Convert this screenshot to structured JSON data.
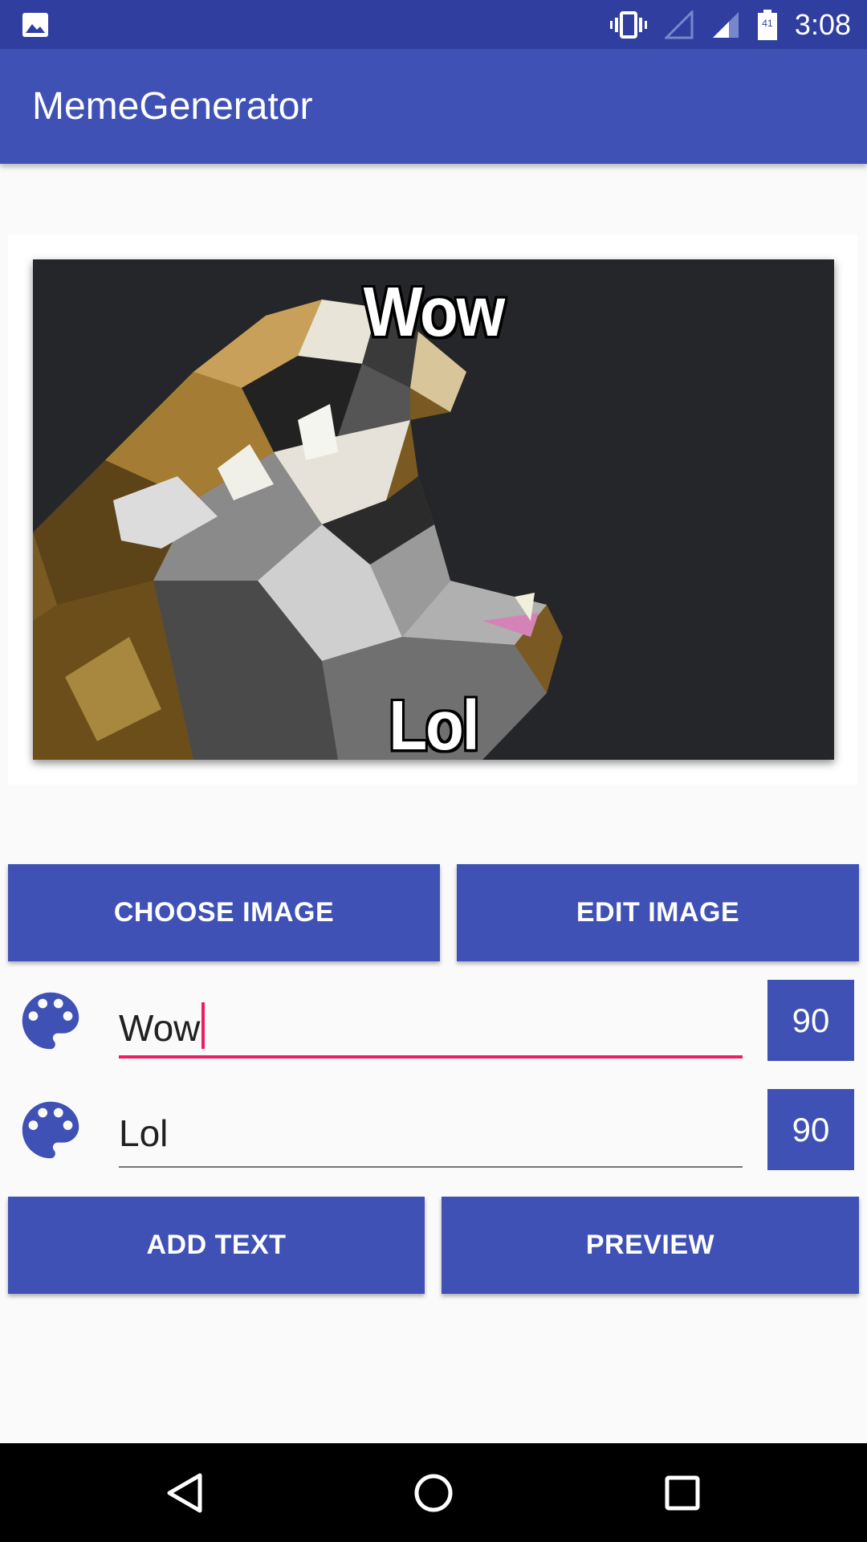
{
  "status_bar": {
    "time": "3:08",
    "battery_level": "41"
  },
  "app_bar": {
    "title": "MemeGenerator"
  },
  "meme": {
    "top_text": "Wow",
    "bottom_text": "Lol"
  },
  "buttons": {
    "choose_image": "CHOOSE IMAGE",
    "edit_image": "EDIT IMAGE",
    "add_text": "ADD TEXT",
    "preview": "PREVIEW"
  },
  "text_rows": [
    {
      "value": "Wow",
      "size": "90",
      "focused": true
    },
    {
      "value": "Lol",
      "size": "90",
      "focused": false
    }
  ],
  "colors": {
    "primary": "#3f51b5",
    "primary_dark": "#303f9f",
    "accent": "#e91e63"
  },
  "icons": [
    "image-notification-icon",
    "vibrate-icon",
    "signal-empty-icon",
    "signal-icon",
    "battery-icon",
    "palette-icon",
    "back-icon",
    "home-icon",
    "recents-icon"
  ]
}
